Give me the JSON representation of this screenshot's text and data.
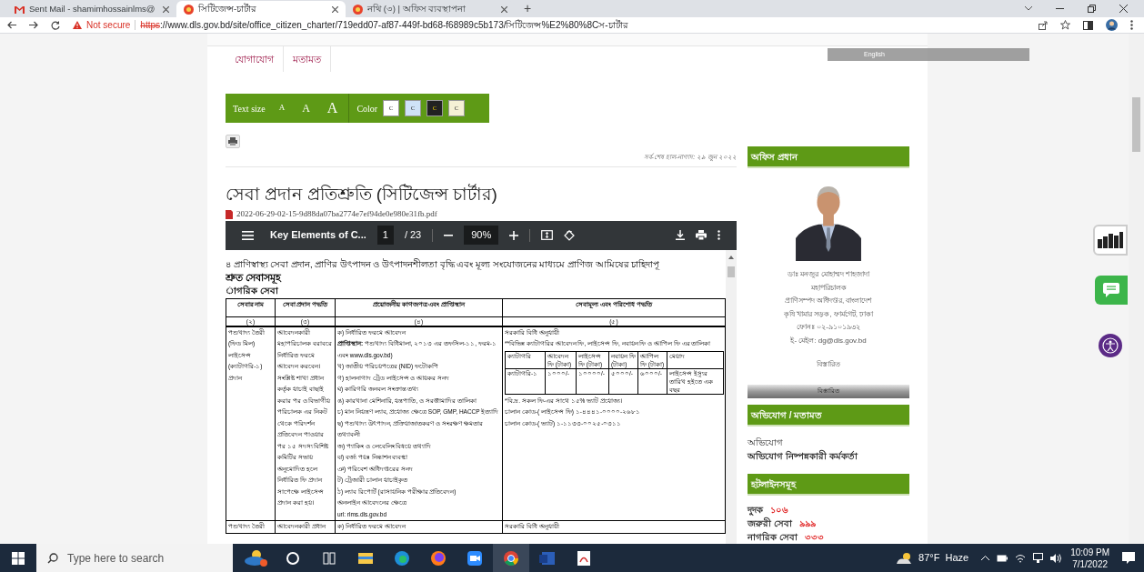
{
  "browser": {
    "tabs": [
      {
        "kind": "mail",
        "title": "Sent Mail - shamimhossainlms@",
        "selected": false
      },
      {
        "kind": "site",
        "title": "সিটিজেন্স-চার্টার",
        "selected": true
      },
      {
        "kind": "site",
        "title": "নথি (৩) | অফিস ব্যবস্থাপনা",
        "selected": false
      }
    ],
    "new_tab": "+",
    "address": {
      "security": "Not secure",
      "scheme": "https",
      "rest": "://www.dls.gov.bd/site/office_citizen_charter/719edd07-af87-449f-bd68-f68989c5b173/সিটিজেন্স%E2%80%8Cস-চার্টার"
    }
  },
  "language_bar": {
    "label": "English"
  },
  "site": {
    "nav": [
      {
        "label": "যোগাযোগ"
      },
      {
        "label": "মতামত"
      }
    ],
    "text_size": {
      "label": "Text size",
      "sizes": [
        "A",
        "A",
        "A"
      ]
    },
    "color_options": {
      "label": "Color",
      "swatches": [
        {
          "label": "C",
          "color": "#ffffff"
        },
        {
          "label": "C",
          "color": "#cfe2f7"
        },
        {
          "label": "C",
          "color": "#222222"
        },
        {
          "label": "C",
          "color": "#f5f0d5"
        }
      ]
    },
    "updated": "সর্ব-শেষ হাল-নাগাদ: ২৯ জুন ২০২২",
    "title": "সেবা প্রদান প্রতিশ্রুতি (সিটিজেন্স চার্টার)",
    "attachment": "2022-06-29-02-15-9d88da07ba2774e7ef94de0e980e31fb.pdf"
  },
  "pdf_viewer": {
    "title": "Key Elements of C...",
    "page": "1",
    "page_count": "/ 23",
    "zoom": "90%",
    "lines": [
      "৪ প্রাণিস্বাস্থ্য সেবা প্রদান, প্রাণির উৎপাদন ও উৎপাদনশীলতা বৃদ্ধি এবং মূল্য সংযোজনের মাধ্যমে প্রাণিজ আমিষের চাহিদাপূ"
    ],
    "heading": "শ্রুত সেবাসমূহ",
    "subheading": "াগরিক সেবা",
    "table": {
      "columns": [
        "সেবার নাম",
        "সেবা প্রদান পদ্ধতি",
        "প্রয়োজনীয় কাগজপত্র এবং প্রাপ্তিস্থান",
        "সেবামূল্য এবং পরিশোধ পদ্ধতি"
      ],
      "numbers": [
        "(২)",
        "(৩)",
        "(৪)",
        "(৫)"
      ],
      "rows": [
        {
          "name": "পশুখাদ্য তৈরী (ফিড মিল) লাইসেন্স (ক্যাটাগরি-১) প্রদান",
          "method": "আবেদনকারী মহাপরিচালক বরাবরে নির্ধারিত ফরমে আবেদন করবেন। সংশ্লিষ্ট শাখা প্রধান কর্তৃক যাচাই বাছাই করার পর ও বিভাগীয় পরিচালক এর নিকট থেকে পরিদর্শন প্রতিবেদন পাওয়ার পর ১৫ সদস্য বিশিষ্ট কমিটির সভায় অনুমোদিত হলে নির্ধারিত ফি প্রদান সাপেক্ষে লাইসেন্স প্রদান করা হয়।",
          "documents": [
            "ক) নির্ধারিত ফরমে আবেদন",
            "**প্রাপ্তিস্থান:** পশুখাদ্য বিধিমালা, ২০১৩ এর তফসিল-১১, ফরম-১ এবং www.dls.gov.bd)",
            "খ) জাতীয় পরিচয়পত্রের (NID) ফটোকপি",
            "গ) হালনাগাদ ট্রেড লাইসেন্স ও আয়কর সনদ",
            "ঘ) কারিগরি জনবল সংক্রান্ত তথ্য",
            "ঙ) কারখানা মেশিনারি, যন্ত্রপাতি, ও সরঞ্জামাদির তালিকা",
            "চ) মান নিয়ন্ত্রণ ল্যাব, প্রযোজ্য ক্ষেত্রে SOP, GMP, HACCP ইত্যাদি",
            "ছ) পশুখাদ্য উৎপাদন, প্রক্রিয়াজাতকরণ ও সংরক্ষণ ক্ষমতার তথ্যাবলী",
            "জ) প্যাকিং ও লেবেলিং বিষয়ে তথ্যাদি",
            "ঝ) বর্জ্য পয়ঃ নিষ্কাশন ব্যবস্থা",
            "ঞ) পরিবেশ অধিদপ্তরের সনদ",
            "ট) ট্রেজারী চালান যাচাইকৃত",
            "ঠ) ল্যাব রিপোর্ট (রাসায়নিক পরীক্ষার প্রতিবেদন)",
            "অনলাইন আবেদনের ক্ষেত্রে",
            "url: rlms.dls.gov.bd"
          ],
          "fee_intro": [
            "সরকারি বিধি  অনুযায়ী",
            "**বিভিন্ন ক্যাটাগরির আবেদন ফি, লাইসেন্স ফি, নবায়ন ফি  ও আপিল ফি এর তালিকা"
          ],
          "fee_table": {
            "columns": [
              "ক্যাটাগরি",
              "আবেদন ফি (টাকা)",
              "লাইসেন্স ফি (টাকা)",
              "নবায়ন ফি (টাকা)",
              "আপিল ফি (টাকা)",
              "মেয়াদ"
            ],
            "row": [
              "ক্যাটাগরি-১",
              "১০০০/-",
              "১০০০০/-",
              "৫০০০/-",
              "৬০০০/-",
              "লাইসেন্স ইস্যুর তারিখ হইতে এক বছর"
            ]
          },
          "fee_notes": [
            "*বি.দ্র. সকল ফি-এর সাথে ১৫% ভ্যাট প্রযোজ্য।",
            "চালান কোড-( লাইসেন্স ফি) ১-৪৪৪১-০০০০-২৬৮১",
            "চালান কোড-( ভ্যাট) ১-১১৩৩-০০২৫-০৩১১"
          ]
        },
        {
          "name": "পশুখাদ্য তৈরী",
          "method": "আবেদনকারী প্রধান",
          "documents": [
            "ক) নির্ধারিত ফরমে আবেদন"
          ],
          "fee_intro": [
            "সরকারি বিধি  অনুযায়ী"
          ]
        }
      ]
    }
  },
  "sidebar": {
    "head_title": "অফিস প্রধান",
    "head_lines": [
      "ডাঃ মনজুর মোহাম্মদ শাহজাদা",
      "মহাপরিচালক",
      "প্রাণিসম্পদ অধিদপ্তর, বাংলাদেশ",
      "কৃষি খামার সড়ক, ফার্মগেট, ঢাকা",
      "ফোনঃ ০২-৯১০১৯৩২",
      "ই- মেইল: dg@dls.gov.bd"
    ],
    "details_link": "বিস্তারিত",
    "details_bar": "বিস্তারিত",
    "complaint_title": "অভিযোগ / মতামত",
    "complaint_links": [
      "অভিযোগ",
      "অভিযোগ নিষ্পন্নকারী কর্মকর্তা"
    ],
    "hotline_title": "হটলাইনসমূহ",
    "hotlines": [
      {
        "name": "দুদক",
        "number": "১০৬"
      },
      {
        "name": "জরুরী সেবা",
        "number": "৯৯৯"
      },
      {
        "name": "নাগরিক সেবা",
        "number": "৩৩৩"
      }
    ]
  },
  "taskbar": {
    "search_placeholder": "Type here to search",
    "weather": "87°F  Haze",
    "time": "10:09 PM",
    "date": "7/1/2022"
  }
}
